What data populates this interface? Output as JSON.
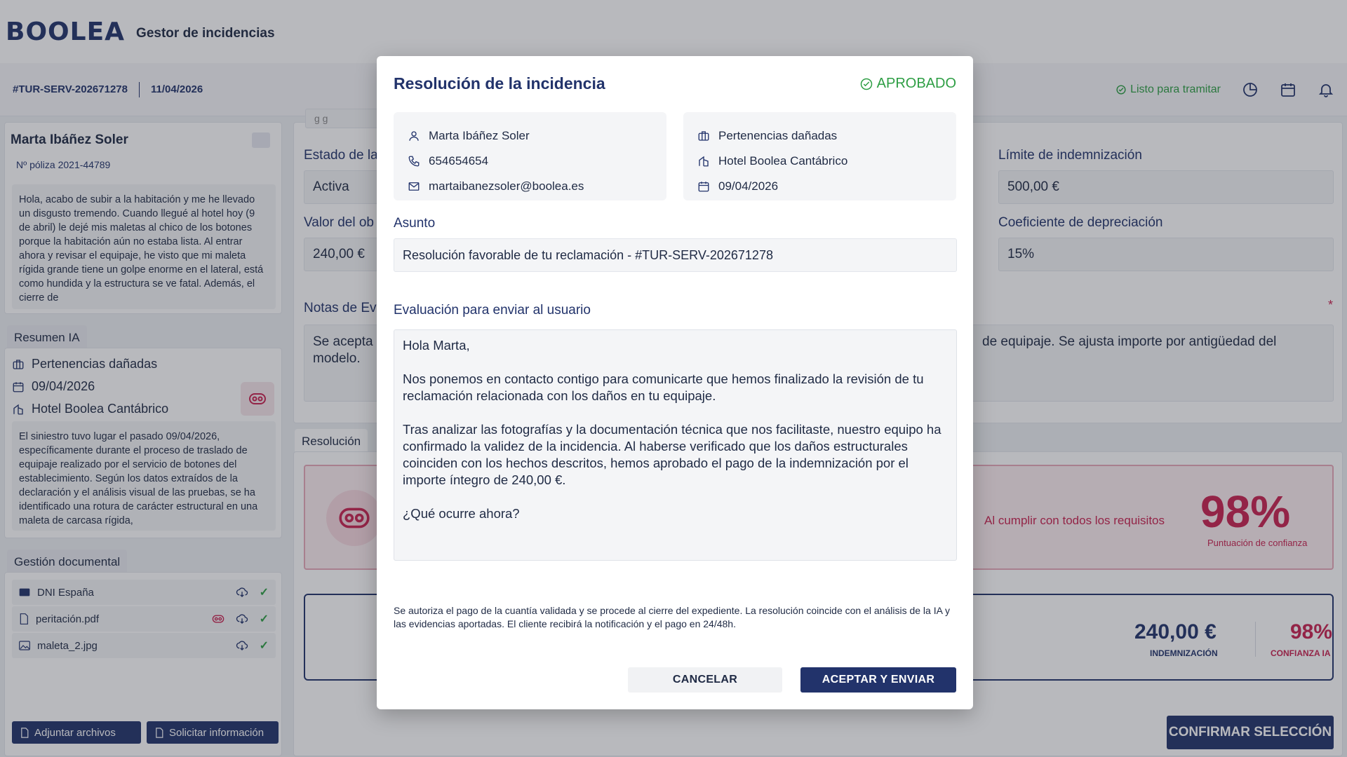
{
  "header": {
    "logo": "BOOLEA",
    "app_title": "Gestor de incidencias"
  },
  "subheader": {
    "case_id": "#TUR-SERV-202671278",
    "case_date": "11/04/2026",
    "status": "Listo para tramitar"
  },
  "client": {
    "name": "Marta Ibáñez Soler",
    "policy": "Nº póliza 2021-44789",
    "message": "Hola, acabo de subir a la habitación y me he llevado un disgusto tremendo. Cuando llegué al hotel hoy (9 de abril) le dejé mis maletas al chico de los botones porque la habitación aún no estaba lista. Al entrar ahora y revisar el equipaje, he visto que mi maleta rígida grande tiene un golpe enorme en el lateral, está como hundida y la estructura se ve fatal. Además, el cierre de"
  },
  "summary": {
    "tab": "Resumen IA",
    "category": "Pertenencias dañadas",
    "date": "09/04/2026",
    "location": "Hotel Boolea Cantábrico",
    "text": "El siniestro tuvo lugar el pasado 09/04/2026, específicamente durante el proceso de traslado de equipaje realizado por el servicio de botones del establecimiento. Según los datos extraídos de la declaración y el análisis visual de las pruebas, se ha identificado una rotura de carácter estructural en una maleta de carcasa rígida,"
  },
  "documents": {
    "tab": "Gestión documental",
    "items": [
      {
        "name": "DNI España"
      },
      {
        "name": "peritación.pdf"
      },
      {
        "name": "maleta_2.jpg"
      }
    ],
    "attach_label": "Adjuntar archivos",
    "request_label": "Solicitar información"
  },
  "form": {
    "estado_label": "Estado de la",
    "estado_value": "Activa",
    "valor_label": "Valor del ob",
    "valor_value": "240,00 €",
    "limite_label": "Límite de indemnización",
    "limite_value": "500,00 €",
    "coef_label": "Coeficiente de depreciación",
    "coef_value": "15%",
    "notas_label": "Notas de Ev",
    "notas_value_start": "Se acepta",
    "notas_value_mid": "de equipaje. Se ajusta importe por antigüedad del",
    "notas_value_end": "modelo.",
    "required_mark": "*",
    "top_partial": "g g"
  },
  "resolution": {
    "tab": "Resolución",
    "cumplir": "Al cumplir con todos los requisitos",
    "confidence": "98%",
    "confidence_caption": "Puntuación de confianza",
    "amount": "240,00 €",
    "amount_caption": "INDEMNIZACIÓN",
    "ia_pct": "98%",
    "ia_caption": "CONFIANZA IA",
    "confirm_label": "CONFIRMAR SELECCIÓN"
  },
  "modal": {
    "title": "Resolución de la incidencia",
    "status": "APROBADO",
    "contact": {
      "name": "Marta Ibáñez Soler",
      "phone": "654654654",
      "email": "martaibanezsoler@boolea.es"
    },
    "incident": {
      "category": "Pertenencias dañadas",
      "hotel": "Hotel Boolea Cantábrico",
      "date": "09/04/2026"
    },
    "subject_label": "Asunto",
    "subject_value": "Resolución favorable de tu reclamación - #TUR-SERV-202671278",
    "eval_label": "Evaluación para enviar al usuario",
    "eval_paragraphs": [
      "Hola Marta,",
      "Nos ponemos en contacto contigo para comunicarte que hemos finalizado la revisión de tu reclamación relacionada con los daños en tu equipaje.",
      "Tras analizar las fotografías y la documentación técnica que nos facilitaste, nuestro equipo ha confirmado la validez de la incidencia. Al haberse verificado que los daños estructurales coinciden con los hechos descritos, hemos aprobado el pago de la indemnización por el importe íntegro de 240,00 €.",
      "¿Qué ocurre ahora?"
    ],
    "footer_note": "Se autoriza el pago de la cuantía validada y se procede al cierre del expediente. La resolución coincide con el análisis de la IA y las evidencias aportadas. El cliente recibirá la notificación y el pago en 24/48h.",
    "cancel_label": "CANCELAR",
    "accept_label": "ACEPTAR Y ENVIAR"
  },
  "colors": {
    "brand": "#22336b",
    "success": "#2e9e44",
    "accent": "#c8224f"
  }
}
